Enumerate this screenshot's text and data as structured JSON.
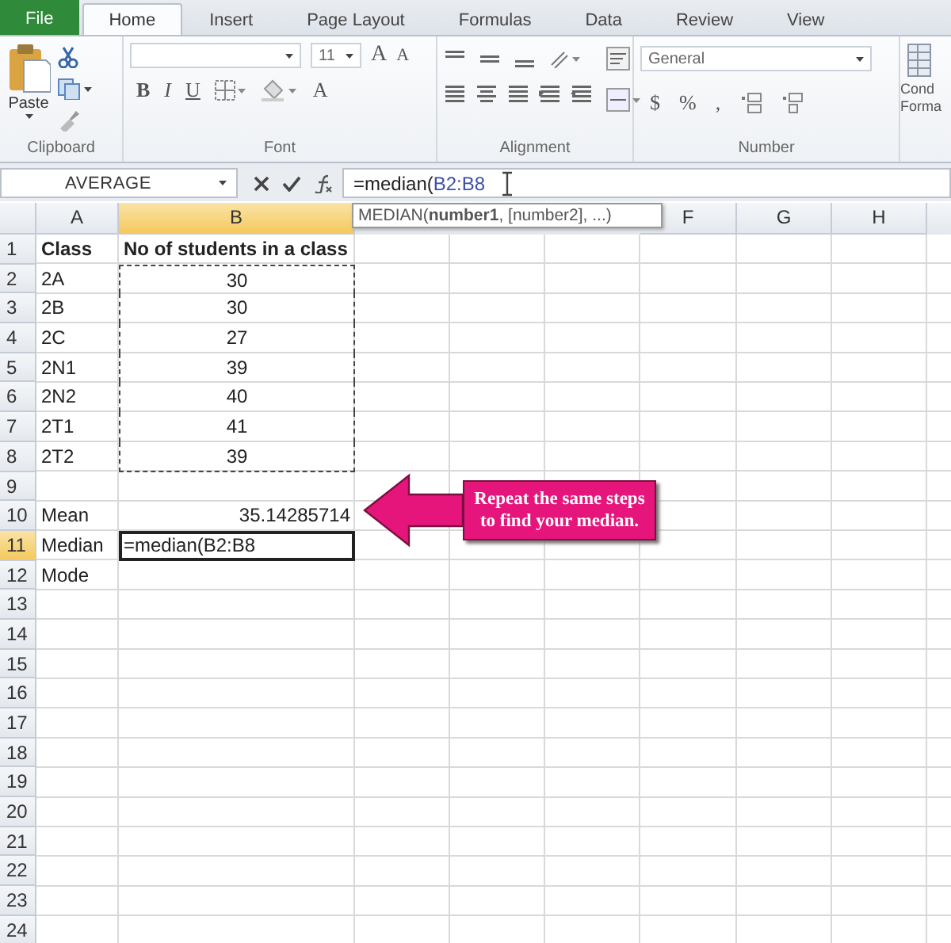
{
  "ribbon": {
    "tabs": [
      {
        "label": "File",
        "kind": "file",
        "selected": false
      },
      {
        "label": "Home",
        "kind": "tab",
        "selected": true
      },
      {
        "label": "Insert",
        "kind": "tab",
        "selected": false
      },
      {
        "label": "Page Layout",
        "kind": "tab",
        "selected": false
      },
      {
        "label": "Formulas",
        "kind": "tab",
        "selected": false
      },
      {
        "label": "Data",
        "kind": "tab",
        "selected": false
      },
      {
        "label": "Review",
        "kind": "tab",
        "selected": false
      },
      {
        "label": "View",
        "kind": "tab",
        "selected": false
      }
    ],
    "clipboard": {
      "label": "Clipboard",
      "paste": "Paste"
    },
    "font": {
      "label": "Font",
      "size": "11",
      "grow": "A",
      "shrink": "A",
      "bold": "B",
      "italic": "I",
      "underline": "U",
      "font_color_button": "A"
    },
    "alignment": {
      "label": "Alignment"
    },
    "number": {
      "label": "Number",
      "format": "General",
      "currency": "$",
      "percent": "%",
      "comma": ","
    },
    "styles": {
      "label": "Cond Forma"
    }
  },
  "formula_bar": {
    "name_box": "AVERAGE",
    "formula": [
      {
        "text": "=median(",
        "kind": "plain"
      },
      {
        "text": "B2:B8",
        "kind": "reference"
      }
    ]
  },
  "sheet": {
    "column_headers": [
      {
        "label": "A",
        "selected": false
      },
      {
        "label": "B",
        "selected": true
      },
      {
        "label": "F",
        "selected": false
      },
      {
        "label": "G",
        "selected": false
      },
      {
        "label": "H",
        "selected": false
      }
    ],
    "tooltip": "MEDIAN(**number1**, [number2], ...)",
    "rows": [
      {
        "number": "1",
        "selected": false,
        "marked": false,
        "cells": [
          {
            "text": "Class",
            "kind": "header"
          },
          {
            "text": "No of students in a class",
            "kind": "header"
          }
        ]
      },
      {
        "number": "2",
        "selected": false,
        "marked": true,
        "cells": [
          {
            "text": "2A",
            "kind": "text"
          },
          {
            "text": "30",
            "kind": "centered"
          }
        ]
      },
      {
        "number": "3",
        "selected": false,
        "marked": true,
        "cells": [
          {
            "text": "2B",
            "kind": "text"
          },
          {
            "text": "30",
            "kind": "centered"
          }
        ]
      },
      {
        "number": "4",
        "selected": false,
        "marked": true,
        "cells": [
          {
            "text": "2C",
            "kind": "text"
          },
          {
            "text": "27",
            "kind": "centered"
          }
        ]
      },
      {
        "number": "5",
        "selected": false,
        "marked": true,
        "cells": [
          {
            "text": "2N1",
            "kind": "text"
          },
          {
            "text": "39",
            "kind": "centered"
          }
        ]
      },
      {
        "number": "6",
        "selected": false,
        "marked": true,
        "cells": [
          {
            "text": "2N2",
            "kind": "text"
          },
          {
            "text": "40",
            "kind": "centered"
          }
        ]
      },
      {
        "number": "7",
        "selected": false,
        "marked": true,
        "cells": [
          {
            "text": "2T1",
            "kind": "text"
          },
          {
            "text": "41",
            "kind": "centered"
          }
        ]
      },
      {
        "number": "8",
        "selected": false,
        "marked": true,
        "cells": [
          {
            "text": "2T2",
            "kind": "text"
          },
          {
            "text": "39",
            "kind": "centered"
          }
        ]
      },
      {
        "number": "9",
        "selected": false,
        "marked": false
      },
      {
        "number": "10",
        "selected": false,
        "marked": false,
        "cells": [
          {
            "text": "Mean",
            "kind": "text"
          },
          {
            "text": "35.14285714",
            "kind": "number"
          }
        ]
      },
      {
        "number": "11",
        "selected": true,
        "marked": false,
        "cells": [
          {
            "text": "Median",
            "kind": "text"
          },
          {
            "text": "=median(B2:B8",
            "kind": "editing"
          }
        ]
      },
      {
        "number": "12",
        "selected": false,
        "marked": false,
        "cells": [
          {
            "text": "Mode",
            "kind": "text"
          }
        ]
      },
      {
        "number": "13",
        "selected": false,
        "marked": false
      },
      {
        "number": "14",
        "selected": false,
        "marked": false
      },
      {
        "number": "15",
        "selected": false,
        "marked": false
      },
      {
        "number": "16",
        "selected": false,
        "marked": false
      },
      {
        "number": "17",
        "selected": false,
        "marked": false
      },
      {
        "number": "18",
        "selected": false,
        "marked": false
      },
      {
        "number": "19",
        "selected": false,
        "marked": false
      },
      {
        "number": "20",
        "selected": false,
        "marked": false
      },
      {
        "number": "21",
        "selected": false,
        "marked": false
      },
      {
        "number": "22",
        "selected": false,
        "marked": false
      },
      {
        "number": "23",
        "selected": false,
        "marked": false
      },
      {
        "number": "24",
        "selected": false,
        "marked": false
      }
    ],
    "callout": "Repeat the same steps to find your median."
  }
}
